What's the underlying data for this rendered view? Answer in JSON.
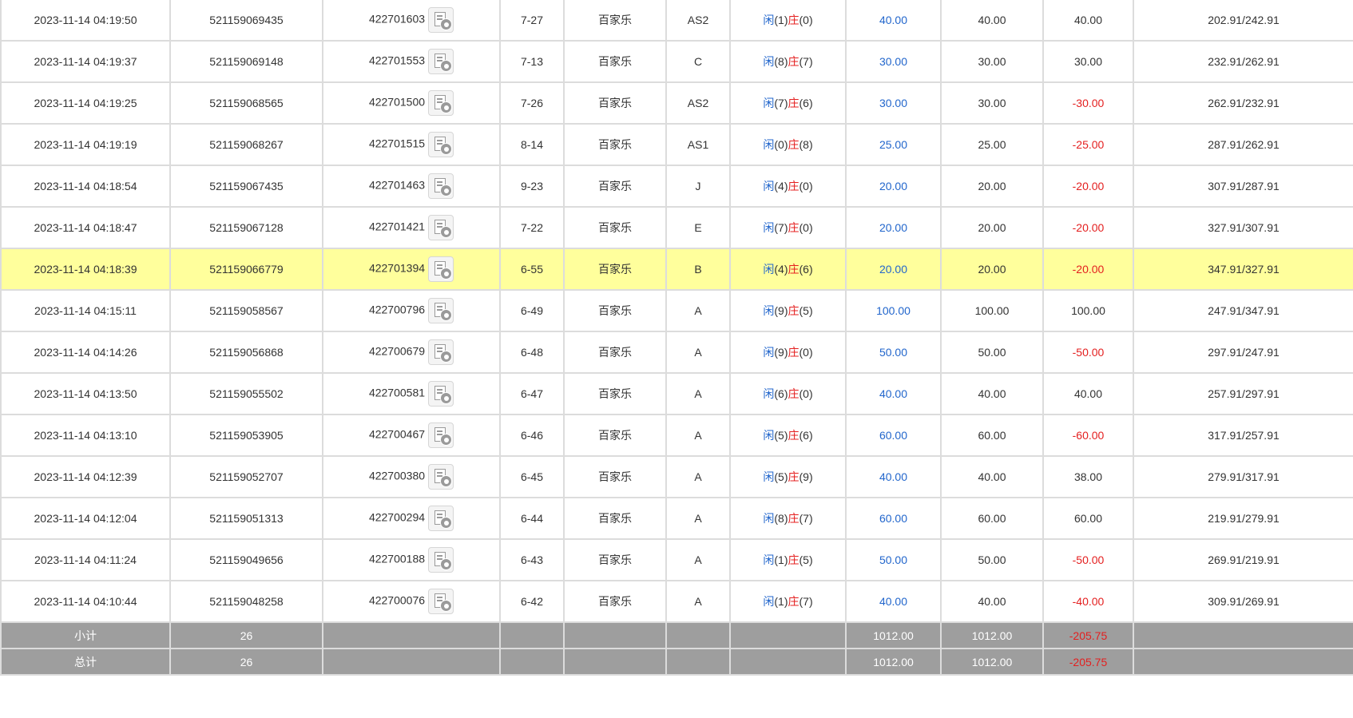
{
  "result_labels": {
    "player": "闲",
    "banker": "庄"
  },
  "rows": [
    {
      "time": "2023-11-14 04:19:50",
      "order_id": "521159069435",
      "round_id": "422701603",
      "shoe": "7-27",
      "game": "百家乐",
      "table": "AS2",
      "player": "1",
      "banker": "0",
      "bet": "40.00",
      "valid_bet": "40.00",
      "win_loss": "40.00",
      "win_negative": false,
      "balance": "202.91/242.91",
      "highlight": false
    },
    {
      "time": "2023-11-14 04:19:37",
      "order_id": "521159069148",
      "round_id": "422701553",
      "shoe": "7-13",
      "game": "百家乐",
      "table": "C",
      "player": "8",
      "banker": "7",
      "bet": "30.00",
      "valid_bet": "30.00",
      "win_loss": "30.00",
      "win_negative": false,
      "balance": "232.91/262.91",
      "highlight": false
    },
    {
      "time": "2023-11-14 04:19:25",
      "order_id": "521159068565",
      "round_id": "422701500",
      "shoe": "7-26",
      "game": "百家乐",
      "table": "AS2",
      "player": "7",
      "banker": "6",
      "bet": "30.00",
      "valid_bet": "30.00",
      "win_loss": "-30.00",
      "win_negative": true,
      "balance": "262.91/232.91",
      "highlight": false
    },
    {
      "time": "2023-11-14 04:19:19",
      "order_id": "521159068267",
      "round_id": "422701515",
      "shoe": "8-14",
      "game": "百家乐",
      "table": "AS1",
      "player": "0",
      "banker": "8",
      "bet": "25.00",
      "valid_bet": "25.00",
      "win_loss": "-25.00",
      "win_negative": true,
      "balance": "287.91/262.91",
      "highlight": false
    },
    {
      "time": "2023-11-14 04:18:54",
      "order_id": "521159067435",
      "round_id": "422701463",
      "shoe": "9-23",
      "game": "百家乐",
      "table": "J",
      "player": "4",
      "banker": "0",
      "bet": "20.00",
      "valid_bet": "20.00",
      "win_loss": "-20.00",
      "win_negative": true,
      "balance": "307.91/287.91",
      "highlight": false
    },
    {
      "time": "2023-11-14 04:18:47",
      "order_id": "521159067128",
      "round_id": "422701421",
      "shoe": "7-22",
      "game": "百家乐",
      "table": "E",
      "player": "7",
      "banker": "0",
      "bet": "20.00",
      "valid_bet": "20.00",
      "win_loss": "-20.00",
      "win_negative": true,
      "balance": "327.91/307.91",
      "highlight": false
    },
    {
      "time": "2023-11-14 04:18:39",
      "order_id": "521159066779",
      "round_id": "422701394",
      "shoe": "6-55",
      "game": "百家乐",
      "table": "B",
      "player": "4",
      "banker": "6",
      "bet": "20.00",
      "valid_bet": "20.00",
      "win_loss": "-20.00",
      "win_negative": true,
      "balance": "347.91/327.91",
      "highlight": true
    },
    {
      "time": "2023-11-14 04:15:11",
      "order_id": "521159058567",
      "round_id": "422700796",
      "shoe": "6-49",
      "game": "百家乐",
      "table": "A",
      "player": "9",
      "banker": "5",
      "bet": "100.00",
      "valid_bet": "100.00",
      "win_loss": "100.00",
      "win_negative": false,
      "balance": "247.91/347.91",
      "highlight": false
    },
    {
      "time": "2023-11-14 04:14:26",
      "order_id": "521159056868",
      "round_id": "422700679",
      "shoe": "6-48",
      "game": "百家乐",
      "table": "A",
      "player": "9",
      "banker": "0",
      "bet": "50.00",
      "valid_bet": "50.00",
      "win_loss": "-50.00",
      "win_negative": true,
      "balance": "297.91/247.91",
      "highlight": false
    },
    {
      "time": "2023-11-14 04:13:50",
      "order_id": "521159055502",
      "round_id": "422700581",
      "shoe": "6-47",
      "game": "百家乐",
      "table": "A",
      "player": "6",
      "banker": "0",
      "bet": "40.00",
      "valid_bet": "40.00",
      "win_loss": "40.00",
      "win_negative": false,
      "balance": "257.91/297.91",
      "highlight": false
    },
    {
      "time": "2023-11-14 04:13:10",
      "order_id": "521159053905",
      "round_id": "422700467",
      "shoe": "6-46",
      "game": "百家乐",
      "table": "A",
      "player": "5",
      "banker": "6",
      "bet": "60.00",
      "valid_bet": "60.00",
      "win_loss": "-60.00",
      "win_negative": true,
      "balance": "317.91/257.91",
      "highlight": false
    },
    {
      "time": "2023-11-14 04:12:39",
      "order_id": "521159052707",
      "round_id": "422700380",
      "shoe": "6-45",
      "game": "百家乐",
      "table": "A",
      "player": "5",
      "banker": "9",
      "bet": "40.00",
      "valid_bet": "40.00",
      "win_loss": "38.00",
      "win_negative": false,
      "balance": "279.91/317.91",
      "highlight": false
    },
    {
      "time": "2023-11-14 04:12:04",
      "order_id": "521159051313",
      "round_id": "422700294",
      "shoe": "6-44",
      "game": "百家乐",
      "table": "A",
      "player": "8",
      "banker": "7",
      "bet": "60.00",
      "valid_bet": "60.00",
      "win_loss": "60.00",
      "win_negative": false,
      "balance": "219.91/279.91",
      "highlight": false
    },
    {
      "time": "2023-11-14 04:11:24",
      "order_id": "521159049656",
      "round_id": "422700188",
      "shoe": "6-43",
      "game": "百家乐",
      "table": "A",
      "player": "1",
      "banker": "5",
      "bet": "50.00",
      "valid_bet": "50.00",
      "win_loss": "-50.00",
      "win_negative": true,
      "balance": "269.91/219.91",
      "highlight": false
    },
    {
      "time": "2023-11-14 04:10:44",
      "order_id": "521159048258",
      "round_id": "422700076",
      "shoe": "6-42",
      "game": "百家乐",
      "table": "A",
      "player": "1",
      "banker": "7",
      "bet": "40.00",
      "valid_bet": "40.00",
      "win_loss": "-40.00",
      "win_negative": true,
      "balance": "309.91/269.91",
      "highlight": false
    }
  ],
  "subtotal": {
    "label": "小计",
    "count": "26",
    "bet": "1012.00",
    "valid_bet": "1012.00",
    "win_loss": "-205.75"
  },
  "total": {
    "label": "总计",
    "count": "26",
    "bet": "1012.00",
    "valid_bet": "1012.00",
    "win_loss": "-205.75"
  },
  "colors": {
    "highlight": "#ffff9c",
    "player_blue": "#2266cc",
    "banker_red": "#e41f1f",
    "summary_bg": "#9e9e9e"
  },
  "icons": {
    "detail": "replay-detail-icon"
  }
}
